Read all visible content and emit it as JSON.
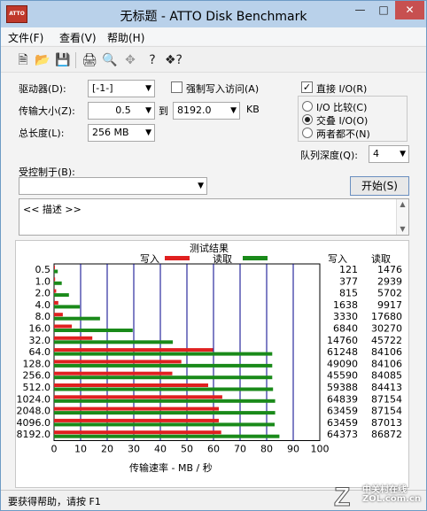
{
  "window": {
    "title": "无标题 - ATTO Disk Benchmark",
    "app_icon_text": "ATTO"
  },
  "menu": [
    "文件(F)",
    "查看(V)",
    "帮助(H)"
  ],
  "toolbar": [
    "new-file-icon",
    "open-folder-icon",
    "save-icon",
    "print-icon",
    "print-preview-icon",
    "move-icon",
    "help-icon",
    "context-help-icon"
  ],
  "settings": {
    "drive_label": "驱动器(D):",
    "drive_value": "[-1-]",
    "force_write_label": "强制写入访问(A)",
    "force_write_checked": false,
    "direct_io_label": "直接 I/O(R)",
    "direct_io_checked": true,
    "transfer_label": "传输大小(Z):",
    "transfer_from": "0.5",
    "transfer_to_label": "到",
    "transfer_to": "8192.0",
    "transfer_unit": "KB",
    "total_label": "总长度(L):",
    "total_value": "256 MB",
    "io_compare_label": "I/O 比较(C)",
    "overlapped_label": "交叠 I/O(O)",
    "neither_label": "两者都不(N)",
    "selected_io_mode": "overlapped",
    "queue_label": "队列深度(Q):",
    "queue_value": "4",
    "controlled_label": "受控制于(B):",
    "controlled_value": "",
    "start_button": "开始(S)",
    "description": "<< 描述 >>"
  },
  "results": {
    "title": "测试结果",
    "legend_write": "写入",
    "legend_read": "读取",
    "col_write": "写入",
    "col_read": "读取",
    "xlabel": "传输速率 - MB / 秒",
    "colors": {
      "write": "#e02020",
      "read": "#1a8a1a",
      "grid": "#00008b"
    }
  },
  "chart_data": {
    "type": "bar",
    "orientation": "horizontal",
    "title": "测试结果",
    "xlabel": "传输速率 - MB / 秒",
    "categories": [
      "0.5",
      "1.0",
      "2.0",
      "4.0",
      "8.0",
      "16.0",
      "32.0",
      "64.0",
      "128.0",
      "256.0",
      "512.0",
      "1024.0",
      "2048.0",
      "4096.0",
      "8192.0"
    ],
    "xlim": [
      0,
      100
    ],
    "xticks": [
      0,
      10,
      20,
      30,
      40,
      50,
      60,
      70,
      80,
      90,
      100
    ],
    "grid": true,
    "series": [
      {
        "name": "写入",
        "values": [
          0.1,
          0.4,
          0.8,
          1.6,
          3.3,
          6.7,
          14.4,
          59.8,
          47.9,
          44.5,
          58.0,
          63.3,
          62.0,
          62.0,
          62.9
        ]
      },
      {
        "name": "读取",
        "values": [
          1.4,
          2.9,
          5.6,
          9.7,
          17.3,
          29.6,
          44.7,
          82.1,
          82.1,
          82.1,
          82.4,
          83.2,
          83.2,
          83.0,
          84.8
        ]
      }
    ],
    "table": {
      "write": [
        "121",
        "377",
        "815",
        "1638",
        "3330",
        "6840",
        "14760",
        "61248",
        "49090",
        "45590",
        "59388",
        "64839",
        "63459",
        "63459",
        "64373"
      ],
      "read": [
        "1476",
        "2939",
        "5702",
        "9917",
        "17680",
        "30270",
        "45722",
        "84106",
        "84106",
        "84085",
        "84413",
        "87154",
        "87154",
        "87013",
        "86872"
      ]
    }
  },
  "status": {
    "text": "要获得帮助，请按 F1"
  },
  "watermark": {
    "brand": "中关村在线",
    "url": "ZOL.com.cn"
  }
}
